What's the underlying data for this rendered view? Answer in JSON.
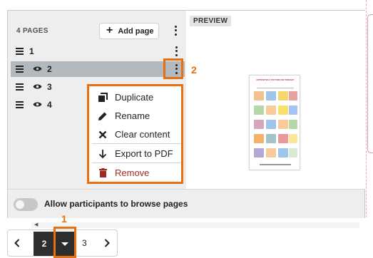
{
  "panel": {
    "pages_count": "4 PAGES",
    "add_page_label": "Add page",
    "preview_label": "PREVIEW"
  },
  "pages": [
    {
      "label": "1",
      "visible": false,
      "active": false
    },
    {
      "label": "2",
      "visible": true,
      "active": true
    },
    {
      "label": "3",
      "visible": true,
      "active": false
    },
    {
      "label": "4",
      "visible": true,
      "active": false
    }
  ],
  "context_menu": {
    "items": [
      {
        "label": "Duplicate",
        "icon": "copy-icon"
      },
      {
        "label": "Rename",
        "icon": "pencil-icon"
      },
      {
        "label": "Clear content",
        "icon": "x-icon"
      },
      {
        "label": "Export to PDF",
        "icon": "arrow-down-icon"
      },
      {
        "label": "Remove",
        "icon": "trash-icon"
      }
    ]
  },
  "preview_thumbnail": {
    "title": "OPPOSITES 2 PICTURE DICTIONARY"
  },
  "footer": {
    "toggle_label": "Allow participants to browse pages",
    "toggle_on": false
  },
  "pager": {
    "current_page": "2",
    "next_page": "3"
  },
  "annotations": {
    "label_1": "1",
    "label_2": "2"
  },
  "colors": {
    "highlight": "#e8700f",
    "remove": "#9e2a1f",
    "active_row": "#b3b9bd",
    "pager_dark": "#2d2d2d"
  }
}
